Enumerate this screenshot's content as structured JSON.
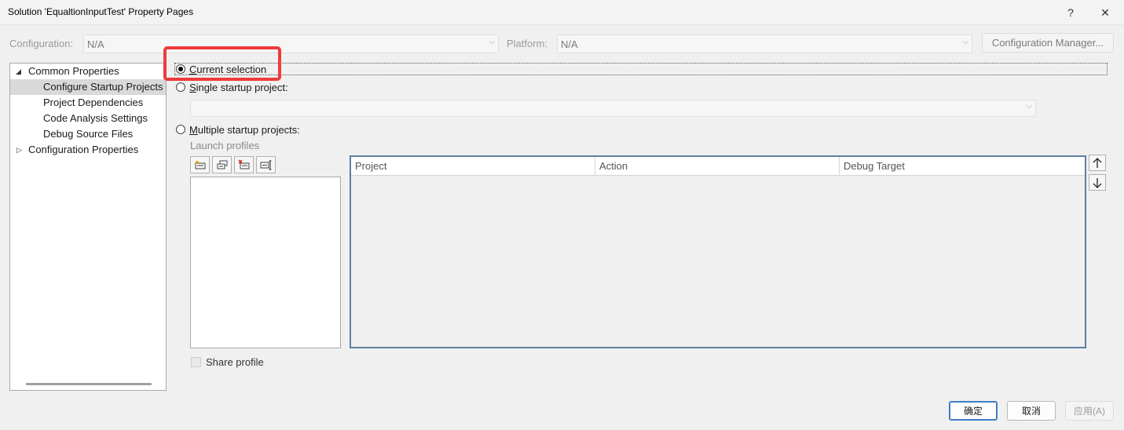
{
  "window": {
    "title": "Solution 'EqualtionInputTest' Property Pages",
    "help_glyph": "?",
    "close_glyph": "✕"
  },
  "config": {
    "configuration_label": "Configuration:",
    "configuration_value": "N/A",
    "platform_label": "Platform:",
    "platform_value": "N/A",
    "manager_label": "Configuration Manager..."
  },
  "tree": {
    "items": [
      {
        "label": "Common Properties",
        "expanded": true
      },
      {
        "label": "Configure Startup Projects",
        "selected": true
      },
      {
        "label": "Project Dependencies"
      },
      {
        "label": "Code Analysis Settings"
      },
      {
        "label": "Debug Source Files"
      },
      {
        "label": "Configuration Properties",
        "expanded": false
      }
    ]
  },
  "startup": {
    "current_selection": {
      "pre": "",
      "key": "C",
      "post": "urrent selection"
    },
    "single": {
      "pre": "",
      "key": "S",
      "post": "ingle startup project:"
    },
    "multiple": {
      "pre": "",
      "key": "M",
      "post": "ultiple startup projects:"
    },
    "launch_profiles_label": "Launch profiles",
    "share_profile_label": "Share profile"
  },
  "grid": {
    "columns": [
      "Project",
      "Action",
      "Debug Target"
    ]
  },
  "buttons": {
    "ok": "确定",
    "cancel": "取消",
    "apply": "应用(A)"
  },
  "icons": {
    "move_up": "🡑",
    "move_down": "🡓"
  },
  "colors": {
    "highlight": "#ef3a3a",
    "grid_border": "#5d7fa3",
    "primary_border": "#3f7bc5"
  }
}
